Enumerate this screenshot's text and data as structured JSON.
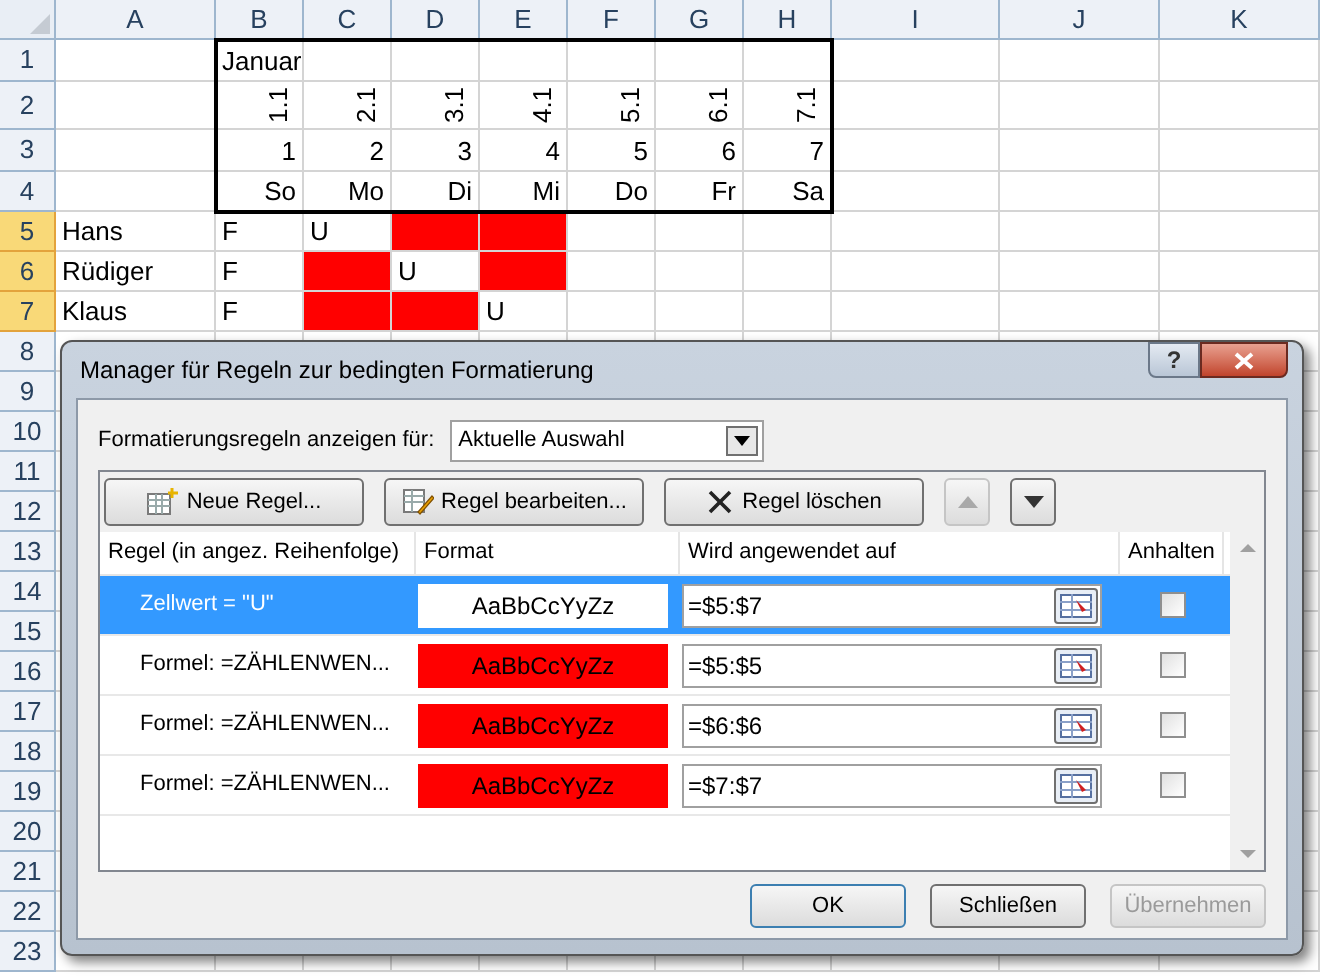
{
  "spreadsheet": {
    "columns": [
      "A",
      "B",
      "C",
      "D",
      "E",
      "F",
      "G",
      "H",
      "I",
      "J",
      "K"
    ],
    "rows": [
      {
        "number": "1",
        "selected": false,
        "kind": "title",
        "cells": [
          {
            "highlighted": false
          },
          {
            "text": "Januar",
            "highlighted": false
          },
          {
            "highlighted": false
          },
          {
            "highlighted": false
          },
          {
            "highlighted": false
          },
          {
            "highlighted": false
          },
          {
            "highlighted": false
          },
          {
            "highlighted": false
          },
          {
            "highlighted": false
          },
          {
            "highlighted": false
          },
          {
            "highlighted": false
          }
        ]
      },
      {
        "number": "2",
        "selected": false,
        "kind": "dates",
        "cells": [
          {
            "highlighted": false
          },
          {
            "text": "1.1",
            "highlighted": false
          },
          {
            "text": "2.1",
            "highlighted": false
          },
          {
            "text": "3.1",
            "highlighted": false
          },
          {
            "text": "4.1",
            "highlighted": false
          },
          {
            "text": "5.1",
            "highlighted": false
          },
          {
            "text": "6.1",
            "highlighted": false
          },
          {
            "text": "7.1",
            "highlighted": false
          },
          {
            "highlighted": false
          },
          {
            "highlighted": false
          },
          {
            "highlighted": false
          }
        ]
      },
      {
        "number": "3",
        "selected": false,
        "kind": "numbers",
        "cells": [
          {
            "highlighted": false
          },
          {
            "text": "1",
            "highlighted": false
          },
          {
            "text": "2",
            "highlighted": false
          },
          {
            "text": "3",
            "highlighted": false
          },
          {
            "text": "4",
            "highlighted": false
          },
          {
            "text": "5",
            "highlighted": false
          },
          {
            "text": "6",
            "highlighted": false
          },
          {
            "text": "7",
            "highlighted": false
          },
          {
            "highlighted": false
          },
          {
            "highlighted": false
          },
          {
            "highlighted": false
          }
        ]
      },
      {
        "number": "4",
        "selected": false,
        "kind": "weekdays",
        "cells": [
          {
            "highlighted": false
          },
          {
            "text": "So",
            "highlighted": false
          },
          {
            "text": "Mo",
            "highlighted": false
          },
          {
            "text": "Di",
            "highlighted": false
          },
          {
            "text": "Mi",
            "highlighted": false
          },
          {
            "text": "Do",
            "highlighted": false
          },
          {
            "text": "Fr",
            "highlighted": false
          },
          {
            "text": "Sa",
            "highlighted": false
          },
          {
            "highlighted": false
          },
          {
            "highlighted": false
          },
          {
            "highlighted": false
          }
        ]
      },
      {
        "number": "5",
        "selected": true,
        "kind": "person",
        "cells": [
          {
            "text": "Hans",
            "highlighted": false
          },
          {
            "text": "F",
            "highlighted": false
          },
          {
            "text": "U",
            "highlighted": false
          },
          {
            "highlighted": true
          },
          {
            "highlighted": true
          },
          {
            "highlighted": false
          },
          {
            "highlighted": false
          },
          {
            "highlighted": false
          },
          {
            "highlighted": false
          },
          {
            "highlighted": false
          },
          {
            "highlighted": false
          }
        ]
      },
      {
        "number": "6",
        "selected": true,
        "kind": "person",
        "cells": [
          {
            "text": "Rüdiger",
            "highlighted": false
          },
          {
            "text": "F",
            "highlighted": false
          },
          {
            "highlighted": true
          },
          {
            "text": "U",
            "highlighted": false
          },
          {
            "highlighted": true
          },
          {
            "highlighted": false
          },
          {
            "highlighted": false
          },
          {
            "highlighted": false
          },
          {
            "highlighted": false
          },
          {
            "highlighted": false
          },
          {
            "highlighted": false
          }
        ]
      },
      {
        "number": "7",
        "selected": true,
        "kind": "person",
        "cells": [
          {
            "text": "Klaus",
            "highlighted": false
          },
          {
            "text": "F",
            "highlighted": false
          },
          {
            "highlighted": true
          },
          {
            "highlighted": true
          },
          {
            "text": "U",
            "highlighted": false
          },
          {
            "highlighted": false
          },
          {
            "highlighted": false
          },
          {
            "highlighted": false
          },
          {
            "highlighted": false
          },
          {
            "highlighted": false
          },
          {
            "highlighted": false
          }
        ]
      },
      {
        "number": "8",
        "selected": false,
        "kind": "person"
      },
      {
        "number": "9",
        "selected": false,
        "kind": "person"
      },
      {
        "number": "10",
        "selected": false,
        "kind": "person"
      },
      {
        "number": "11",
        "selected": false,
        "kind": "person"
      },
      {
        "number": "12",
        "selected": false,
        "kind": "person"
      },
      {
        "number": "13",
        "selected": false,
        "kind": "person"
      },
      {
        "number": "14",
        "selected": false,
        "kind": "person"
      },
      {
        "number": "15",
        "selected": false,
        "kind": "person"
      },
      {
        "number": "16",
        "selected": false,
        "kind": "person"
      },
      {
        "number": "17",
        "selected": false,
        "kind": "person"
      },
      {
        "number": "18",
        "selected": false,
        "kind": "person"
      },
      {
        "number": "19",
        "selected": false,
        "kind": "person"
      },
      {
        "number": "20",
        "selected": false,
        "kind": "person"
      },
      {
        "number": "21",
        "selected": false,
        "kind": "person"
      },
      {
        "number": "22",
        "selected": false,
        "kind": "person"
      },
      {
        "number": "23",
        "selected": false,
        "kind": "person"
      }
    ]
  },
  "dialog": {
    "title": "Manager für Regeln zur bedingten Formatierung",
    "help_button": "?",
    "show_for": {
      "label": "Formatierungsregeln anzeigen für:",
      "value": "Aktuelle Auswahl"
    },
    "toolbar": [
      {
        "kind": "new",
        "label": "Neue Regel...",
        "disabled": false
      },
      {
        "kind": "edit",
        "label": "Regel bearbeiten...",
        "disabled": false
      },
      {
        "kind": "delete",
        "label": "Regel löschen",
        "disabled": false
      },
      {
        "kind": "up",
        "disabled": true
      },
      {
        "kind": "down",
        "disabled": false
      }
    ],
    "columns": [
      "Regel (in angez. Reihenfolge)",
      "Format",
      "Wird angewendet auf",
      "Anhalten"
    ],
    "rules": [
      {
        "rule": "Zellwert = \"U\"",
        "format": "AaBbCcYyZz",
        "color": "#ffffff",
        "applies_to": "=$5:$7",
        "checked": false,
        "selected": true
      },
      {
        "rule": "Formel: =ZÄHLENWEN...",
        "format": "AaBbCcYyZz",
        "color": "#ff0000",
        "applies_to": "=$5:$5",
        "checked": false,
        "selected": false
      },
      {
        "rule": "Formel: =ZÄHLENWEN...",
        "format": "AaBbCcYyZz",
        "color": "#ff0000",
        "applies_to": "=$6:$6",
        "checked": false,
        "selected": false
      },
      {
        "rule": "Formel: =ZÄHLENWEN...",
        "format": "AaBbCcYyZz",
        "color": "#ff0000",
        "applies_to": "=$7:$7",
        "checked": false,
        "selected": false
      }
    ],
    "buttons": [
      {
        "label": "OK",
        "default": true,
        "disabled": false
      },
      {
        "label": "Schließen",
        "default": false,
        "disabled": false
      },
      {
        "label": "Übernehmen",
        "default": false,
        "disabled": true
      }
    ]
  }
}
